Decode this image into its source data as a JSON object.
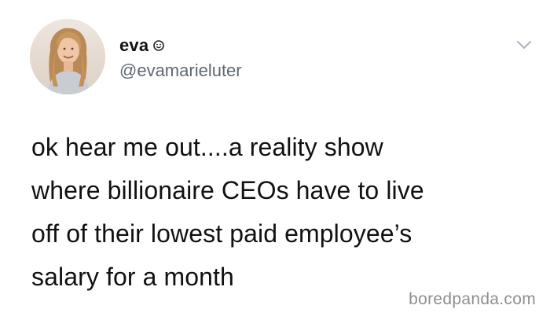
{
  "user": {
    "display_name": "eva",
    "handle": "@evamarieluter",
    "name_emoji": "smiley-emoji-icon"
  },
  "header": {
    "menu_icon": "chevron-down-icon"
  },
  "tweet": {
    "text": "ok hear me out....a reality show\nwhere billionaire CEOs have to live\noff of their lowest paid employee’s\nsalary for a month"
  },
  "watermark": {
    "text": "boredpanda.com"
  },
  "colors": {
    "text": "#111111",
    "handle": "#5f6770",
    "watermark": "#8f8f8f",
    "background": "#ffffff"
  }
}
